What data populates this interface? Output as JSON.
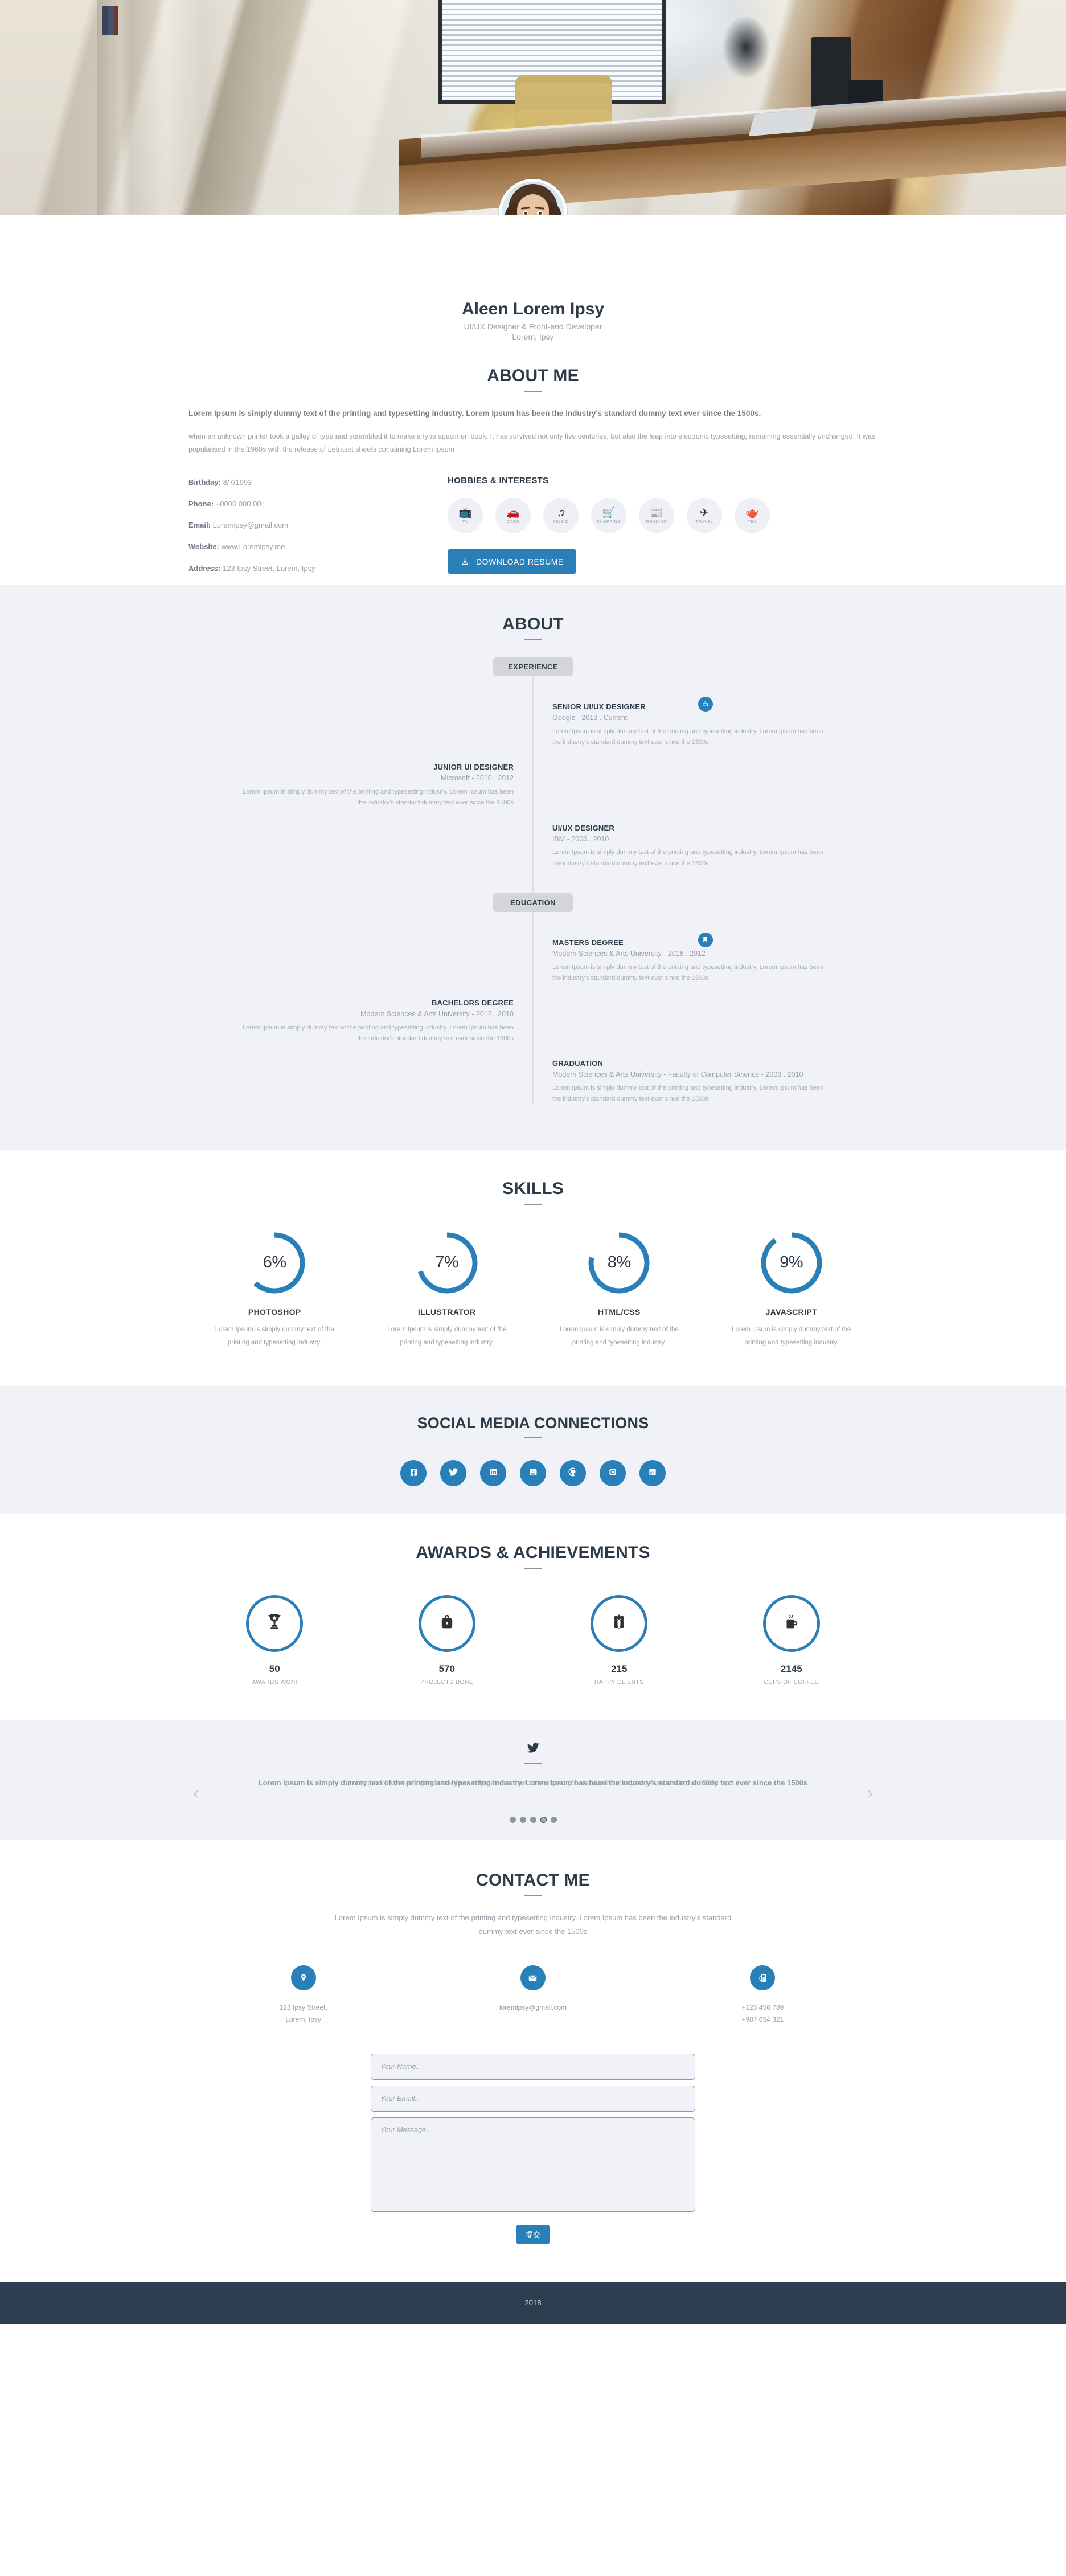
{
  "hero": {
    "image_alt": "office-desk-photo",
    "avatar_alt": "profile-portrait"
  },
  "profile": {
    "name": "Aleen Lorem Ipsy",
    "role": "UI/UX Designer & Front-end Developer",
    "location": "Lorem, Ipsy"
  },
  "about_me": {
    "heading": "ABOUT ME",
    "lead": "Lorem Ipsum is simply dummy text of the printing and typesetting industry. Lorem Ipsum has been the industry's standard dummy text ever since the 1500s.",
    "body": "when an unknown printer took a galley of type and scrambled it to make a type specimen book. It has survived not only five centuries, but also the leap into electronic typesetting, remaining essentially unchanged. It was popularised in the 1960s with the release of Letraset sheets containing Lorem Ipsum",
    "info": [
      {
        "label": "Birthday:",
        "value": "8/7/1993"
      },
      {
        "label": "Phone:",
        "value": "+0000 000 00"
      },
      {
        "label": "Email:",
        "value": "Loremipsy@gmail.com"
      },
      {
        "label": "Website:",
        "value": "www.Loremipsy.me"
      },
      {
        "label": "Address:",
        "value": "123 Ipsy Street, Lorem, Ipsy"
      }
    ],
    "hobbies_title": "HOBBIES & INTERESTS",
    "hobbies": [
      {
        "label": "TV",
        "icon": "tv-icon",
        "glyph": "📺"
      },
      {
        "label": "CARS",
        "icon": "car-icon",
        "glyph": "🚗"
      },
      {
        "label": "MUSIC",
        "icon": "music-icon",
        "glyph": "♫"
      },
      {
        "label": "SHOPPING",
        "icon": "cart-icon",
        "glyph": "🛒"
      },
      {
        "label": "READING",
        "icon": "newspaper-icon",
        "glyph": "📰"
      },
      {
        "label": "TRAVEL",
        "icon": "airplane-icon",
        "glyph": "✈"
      },
      {
        "label": "TEA",
        "icon": "teapot-icon",
        "glyph": "🫖"
      }
    ],
    "download_label": "DOWNLOAD RESUME"
  },
  "about_section": {
    "heading": "ABOUT",
    "experience_badge": "EXPERIENCE",
    "education_badge": "EDUCATION",
    "experience": [
      {
        "side": "right",
        "title": "SENIOR UI/UX DESIGNER",
        "meta": "Google - 2013 . Current",
        "desc": "Lorem Ipsum is simply dummy text of the printing and typesetting industry. Lorem Ipsum has been the industry's standard dummy text ever since the 1500s"
      },
      {
        "side": "left",
        "title": "JUNIOR UI DESIGNER",
        "meta": "Microsoft - 2010 . 2012",
        "desc": "Lorem Ipsum is simply dummy text of the printing and typesetting industry. Lorem Ipsum has been the industry's standard dummy text ever since the 1500s"
      },
      {
        "side": "right",
        "title": "UI/UX DESIGNER",
        "meta": "IBM - 2006 . 2010",
        "desc": "Lorem Ipsum is simply dummy text of the printing and typesetting industry. Lorem Ipsum has been the industry's standard dummy text ever since the 1500s"
      }
    ],
    "education": [
      {
        "side": "right",
        "title": "MASTERS DEGREE",
        "meta": "Modern Sciences & Arts University - 2018 . 2012",
        "desc": "Lorem Ipsum is simply dummy text of the printing and typesetting industry. Lorem Ipsum has been the industry's standard dummy text ever since the 1500s"
      },
      {
        "side": "left",
        "title": "BACHELORS DEGREE",
        "meta": "Modern Sciences & Arts University - 2012 . 2010",
        "desc": "Lorem Ipsum is simply dummy text of the printing and typesetting industry. Lorem Ipsum has been the industry's standard dummy text ever since the 1500s"
      },
      {
        "side": "right",
        "title": "GRADUATION",
        "meta": "Modern Sciences & Arts University - Faculty of Computer Science - 2006 . 2010",
        "desc": "Lorem Ipsum is simply dummy text of the printing and typesetting industry. Lorem Ipsum has been the industry's standard dummy text ever since the 1500s"
      }
    ]
  },
  "skills": {
    "heading": "SKILLS",
    "accent": "#2980b9",
    "items": [
      {
        "name": "PHOTOSHOP",
        "percent_label": "6%",
        "arc_fraction": 0.62,
        "desc": "Lorem Ipsum is simply dummy text of the printing and typesetting industry."
      },
      {
        "name": "ILLUSTRATOR",
        "percent_label": "7%",
        "arc_fraction": 0.7,
        "desc": "Lorem Ipsum is simply dummy text of the printing and typesetting industry."
      },
      {
        "name": "HTML/CSS",
        "percent_label": "8%",
        "arc_fraction": 0.78,
        "desc": "Lorem Ipsum is simply dummy text of the printing and typesetting industry."
      },
      {
        "name": "JAVASCRIPT",
        "percent_label": "9%",
        "arc_fraction": 0.9,
        "desc": "Lorem Ipsum is simply dummy text of the printing and typesetting industry."
      }
    ]
  },
  "social": {
    "heading": "SOCIAL MEDIA CONNECTIONS",
    "accent": "#2980b9",
    "items": [
      {
        "name": "facebook-icon",
        "label": "Facebook"
      },
      {
        "name": "twitter-icon",
        "label": "Twitter"
      },
      {
        "name": "linkedin-icon",
        "label": "LinkedIn"
      },
      {
        "name": "youtube-icon",
        "label": "YouTube"
      },
      {
        "name": "github-icon",
        "label": "GitHub"
      },
      {
        "name": "instagram-icon",
        "label": "Instagram"
      },
      {
        "name": "googleplus-icon",
        "label": "Google Plus"
      }
    ]
  },
  "awards": {
    "heading": "AWARDS & ACHIEVEMENTS",
    "items": [
      {
        "number": "50",
        "label": "AWARDS WON!",
        "icon": "trophy-icon"
      },
      {
        "number": "570",
        "label": "PROJECTS DONE",
        "icon": "briefcase-icon"
      },
      {
        "number": "215",
        "label": "HAPPY CLIENTS",
        "icon": "people-icon"
      },
      {
        "number": "2145",
        "label": "CUPS OF COFFEE",
        "icon": "coffee-icon"
      }
    ]
  },
  "testimonials": {
    "icon": "twitter-bird-icon",
    "slide_outgoing": "printing and typesetting industry. Lorem Ipsum has been the industry's standard dummy text ever since the 1500s",
    "slide_incoming": "Lorem Ipsum is simply dummy text of the printing and typesetting industry. Lorem Ipsum has been the industry's standard dummy text ever since the 1500s",
    "prev_label": "‹",
    "next_label": "›",
    "dot_count": 5,
    "active_dot": 4
  },
  "contact": {
    "heading": "CONTACT ME",
    "intro": "Lorem Ipsum is simply dummy text of the printing and typesetting industry. Lorem Ipsum has been the industry's standard dummy text ever since the 1500s",
    "cards": [
      {
        "icon": "map-pin-icon",
        "text": "123 Ipsy Street,\nLorem, Ipsy"
      },
      {
        "icon": "envelope-icon",
        "text": "loremipsy@gmail.com"
      },
      {
        "icon": "telephone-icon",
        "text": "+123 456 789\n+987 654 321"
      }
    ],
    "form": {
      "name_placeholder": "Your Name..",
      "email_placeholder": "Your Email..",
      "message_placeholder": "Your Message..",
      "submit_label": "提交"
    }
  },
  "footer": {
    "text": "2018"
  }
}
